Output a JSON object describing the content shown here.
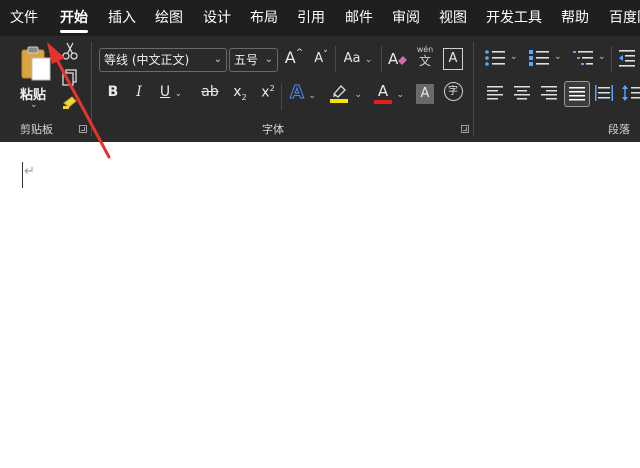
{
  "menu_tabs": [
    "文件",
    "开始",
    "插入",
    "绘图",
    "设计",
    "布局",
    "引用",
    "邮件",
    "审阅",
    "视图",
    "开发工具",
    "帮助",
    "百度网"
  ],
  "active_tab": "开始",
  "clipboard": {
    "paste_label": "粘贴",
    "group_label": "剪贴板"
  },
  "font": {
    "font_name": "等线 (中文正文)",
    "font_size": "五号",
    "grow_label": "A",
    "shrink_label": "A",
    "case_label": "Aa",
    "phonetic_top": "wén",
    "phonetic_bottom": "文",
    "border_label": "A",
    "bold": "B",
    "italic": "I",
    "underline": "U",
    "strike": "ab",
    "subscript": "x",
    "subscript_mark": "2",
    "superscript": "x",
    "superscript_mark": "2",
    "effects_label": "A",
    "font_color_label": "A",
    "shade_label": "A",
    "enclose_label": "字",
    "group_label": "字体"
  },
  "paragraph": {
    "group_label": "段落"
  },
  "colors": {
    "menubar_bg": "#1f1f1f",
    "ribbon_bg": "#2a2a2a",
    "highlight": "#f6e500",
    "font_color": "#e21f1f",
    "annotation_arrow": "#e5342c",
    "effects_blue": "#4a8cff"
  },
  "document": {
    "paragraph_mark": "↵"
  }
}
